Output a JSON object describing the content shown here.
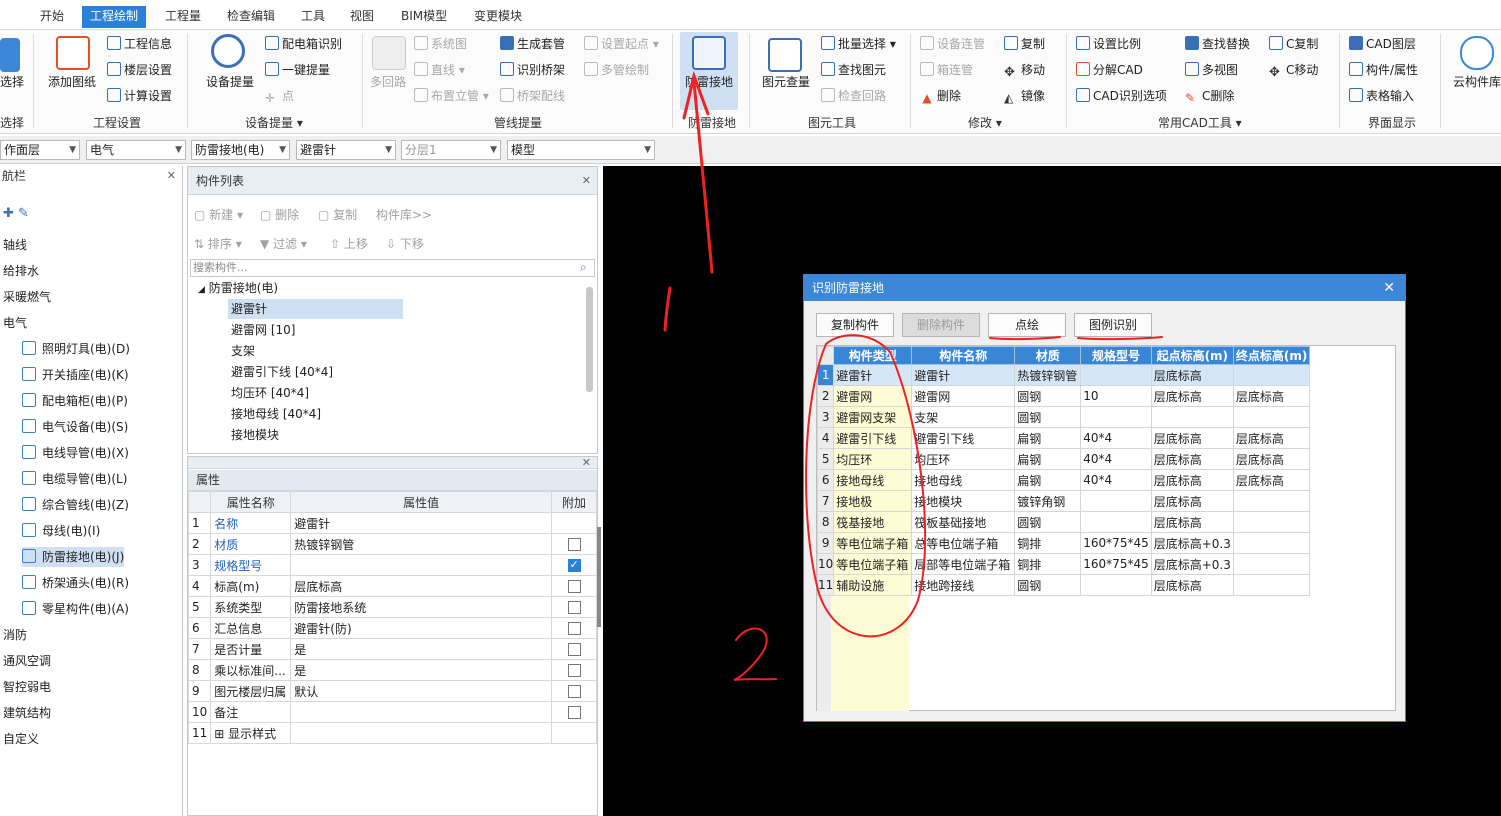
{
  "menu": {
    "items": [
      "开始",
      "工程绘制",
      "工程量",
      "检查编辑",
      "工具",
      "视图",
      "BIM模型",
      "变更模块"
    ],
    "active_index": 1
  },
  "ribbon": {
    "select": {
      "label": "选择",
      "group": "选择"
    },
    "add_drawing": "添加图纸",
    "project_settings": {
      "info": "工程信息",
      "floor": "楼层设置",
      "calc": "计算设置",
      "group": "工程设置"
    },
    "device_extract": {
      "main": "设备提量",
      "panel_recog": "配电箱识别",
      "one_key": "一键提量",
      "point": "点",
      "group": "设备提量"
    },
    "pipeline": {
      "multi_loop": "多回路",
      "system_diagram": "系统图",
      "straight_line": "直线",
      "layout_riser": "布置立管",
      "gen_fitting": "生成套管",
      "recog_tray": "识别桥架",
      "tray_wiring": "桥架配线",
      "set_start": "设置起点",
      "multi_pipe": "多管绘制",
      "group": "管线提量"
    },
    "lightning": {
      "main": "防雷接地",
      "group": "防雷接地"
    },
    "element_tools": {
      "element_qty": "图元查量",
      "batch_select": "批量选择",
      "find_element": "查找图元",
      "check_loop": "检查回路",
      "group": "图元工具"
    },
    "modify": {
      "device_connect": "设备连管",
      "box_connect": "箱连管",
      "delete": "删除",
      "copy": "复制",
      "move": "移动",
      "mirror": "镜像",
      "group": "修改"
    },
    "cad_tools": {
      "set_scale": "设置比例",
      "explode": "分解CAD",
      "cad_options": "CAD识别选项",
      "find_replace": "查找替换",
      "multi_view": "多视图",
      "c_delete": "C删除",
      "c_copy": "C复制",
      "c_move": "C移动",
      "group": "常用CAD工具"
    },
    "display": {
      "cad_layer": "CAD图层",
      "comp_attr": "构件/属性",
      "table_input": "表格输入",
      "group": "界面显示"
    },
    "cloud": "云构件库"
  },
  "dropdowns": [
    "作面层",
    "电气",
    "防雷接地(电)",
    "避雷针",
    "分层1",
    "模型"
  ],
  "nav": {
    "title": "航栏",
    "items": [
      "轴线",
      "给排水",
      "采暖燃气",
      "电气"
    ],
    "sub_items": [
      "照明灯具(电)(D)",
      "开关插座(电)(K)",
      "配电箱柜(电)(P)",
      "电气设备(电)(S)",
      "电线导管(电)(X)",
      "电缆导管(电)(L)",
      "综合管线(电)(Z)",
      "母线(电)(I)",
      "防雷接地(电)(J)",
      "桥架通头(电)(R)",
      "零星构件(电)(A)"
    ],
    "selected_sub": 8,
    "more_items": [
      "消防",
      "通风空调",
      "智控弱电",
      "建筑结构",
      "自定义"
    ]
  },
  "component_list": {
    "title": "构件列表",
    "toolbar": [
      "新建",
      "删除",
      "复制",
      "构件库>>",
      "排序",
      "过滤",
      "上移",
      "下移"
    ],
    "search_placeholder": "搜索构件...",
    "root": "防雷接地(电)",
    "children": [
      "避雷针",
      "避雷网 [10]",
      "支架",
      "避雷引下线 [40*4]",
      "均压环 [40*4]",
      "接地母线 [40*4]",
      "接地模块"
    ],
    "selected_index": 0
  },
  "properties": {
    "title": "属性",
    "headers": [
      "属性名称",
      "属性值",
      "附加"
    ],
    "rows": [
      {
        "n": "1",
        "name": "名称",
        "value": "避雷针",
        "blue": true,
        "checked": false,
        "hascb": false
      },
      {
        "n": "2",
        "name": "材质",
        "value": "热镀锌钢管",
        "blue": true,
        "checked": false,
        "hascb": true
      },
      {
        "n": "3",
        "name": "规格型号",
        "value": "",
        "blue": true,
        "checked": true,
        "hascb": true
      },
      {
        "n": "4",
        "name": "标高(m)",
        "value": "层底标高",
        "blue": false,
        "checked": false,
        "hascb": true
      },
      {
        "n": "5",
        "name": "系统类型",
        "value": "防雷接地系统",
        "blue": false,
        "checked": false,
        "hascb": true
      },
      {
        "n": "6",
        "name": "汇总信息",
        "value": "避雷针(防)",
        "blue": false,
        "checked": false,
        "hascb": true
      },
      {
        "n": "7",
        "name": "是否计量",
        "value": "是",
        "blue": false,
        "checked": false,
        "hascb": true
      },
      {
        "n": "8",
        "name": "乘以标准间...",
        "value": "是",
        "blue": false,
        "checked": false,
        "hascb": true
      },
      {
        "n": "9",
        "name": "图元楼层归属",
        "value": "默认",
        "blue": false,
        "checked": false,
        "hascb": true
      },
      {
        "n": "10",
        "name": "备注",
        "value": "",
        "blue": false,
        "checked": false,
        "hascb": true
      },
      {
        "n": "11",
        "name": "显示样式",
        "value": "",
        "blue": false,
        "checked": false,
        "hascb": false
      }
    ]
  },
  "dialog": {
    "title": "识别防雷接地",
    "buttons": {
      "copy": "复制构件",
      "delete": "删除构件",
      "point_draw": "点绘",
      "legend_recog": "图例识别"
    },
    "headers": [
      "构件类型",
      "构件名称",
      "材质",
      "规格型号",
      "起点标高(m)",
      "终点标高(m)"
    ],
    "rows": [
      [
        "1",
        "避雷针",
        "避雷针",
        "热镀锌钢管",
        "",
        "层底标高",
        ""
      ],
      [
        "2",
        "避雷网",
        "避雷网",
        "圆钢",
        "10",
        "层底标高",
        "层底标高"
      ],
      [
        "3",
        "避雷网支架",
        "支架",
        "圆钢",
        "",
        "",
        ""
      ],
      [
        "4",
        "避雷引下线",
        "避雷引下线",
        "扁钢",
        "40*4",
        "层底标高",
        "层底标高"
      ],
      [
        "5",
        "均压环",
        "均压环",
        "扁钢",
        "40*4",
        "层底标高",
        "层底标高"
      ],
      [
        "6",
        "接地母线",
        "接地母线",
        "扁钢",
        "40*4",
        "层底标高",
        "层底标高"
      ],
      [
        "7",
        "接地极",
        "接地模块",
        "镀锌角钢",
        "",
        "层底标高",
        ""
      ],
      [
        "8",
        "筏基接地",
        "筏板基础接地",
        "圆钢",
        "",
        "层底标高",
        ""
      ],
      [
        "9",
        "等电位端子箱",
        "总等电位端子箱",
        "铜排",
        "160*75*45",
        "层底标高+0.3",
        ""
      ],
      [
        "10",
        "等电位端子箱",
        "局部等电位端子箱",
        "铜排",
        "160*75*45",
        "层底标高+0.3",
        ""
      ],
      [
        "11",
        "辅助设施",
        "接地跨接线",
        "圆钢",
        "",
        "层底标高",
        ""
      ]
    ]
  },
  "annotations": {
    "one": "1",
    "two": "2"
  },
  "colors": {
    "accent": "#2b80d8",
    "dialog_header": "#3d87d8",
    "annotation": "#ee2222",
    "highlight_yellow": "#fdfcd4"
  }
}
